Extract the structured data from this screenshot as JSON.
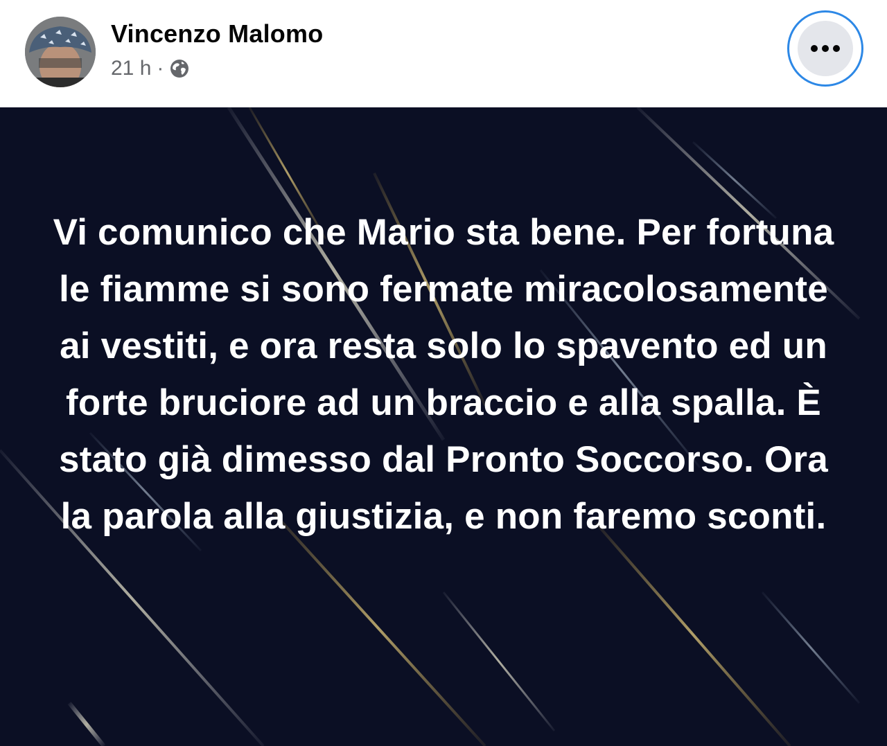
{
  "post": {
    "author_name": "Vincenzo Malomo",
    "timestamp": "21 h",
    "separator": "·",
    "audience_icon": "globe-icon",
    "more_icon": "more-options-icon",
    "text": "Vi comunico che Mario sta bene. Per fortuna le fiamme si sono fermate miracolosamente ai vestiti, e ora resta solo lo spavento ed un forte bruciore ad un braccio e alla spalla. È stato già dimesso dal Pronto Soccorso. Ora la parola alla giustizia, e non faremo sconti."
  },
  "colors": {
    "media_background": "#0b0f24",
    "text": "#ffffff",
    "meta_text": "#65676b",
    "focus_ring": "#2d88e6",
    "button_background": "#e4e6eb"
  }
}
